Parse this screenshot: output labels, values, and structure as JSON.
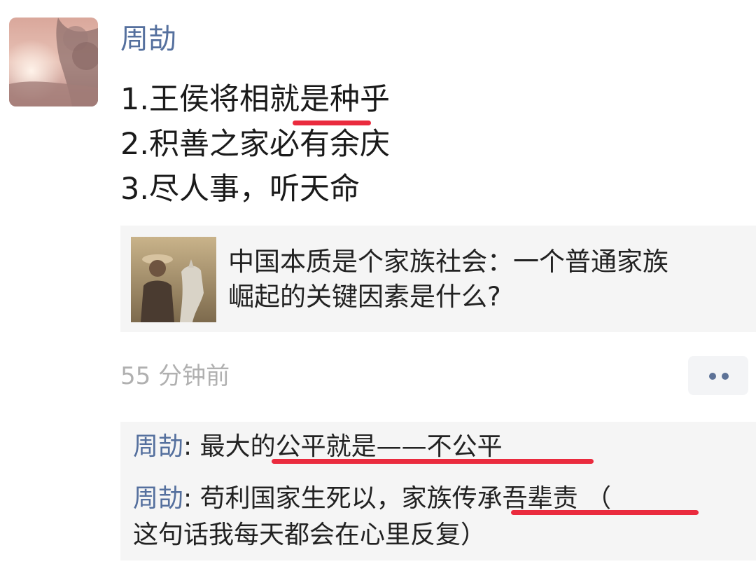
{
  "post": {
    "author": "周劼",
    "lines": [
      "1.王侯将相就是种乎",
      "2.积善之家必有余庆",
      "3.尽人事，听天命"
    ],
    "timestamp": "55 分钟前"
  },
  "link_card": {
    "title_line1": "中国本质是个家族社会：一个普通家族",
    "title_line2": "崛起的关键因素是什么?"
  },
  "comments": [
    {
      "name": "周劼",
      "separator": ": ",
      "text": "最大的公平就是——不公平"
    },
    {
      "name": "周劼",
      "separator": ": ",
      "text": "苟利国家生死以，家族传承吾辈责 （",
      "text_line2": "这句话我每天都会在心里反复）"
    }
  ],
  "colors": {
    "name": "#55709e",
    "underline": "#ea2b3e",
    "timestamp": "#b0b0b0",
    "card_bg": "#f5f5f5"
  },
  "icons": [
    "avatar-image",
    "link-thumbnail-image",
    "more-dots-icon"
  ]
}
